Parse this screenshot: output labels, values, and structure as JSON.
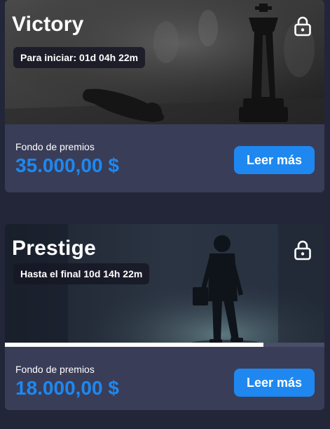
{
  "cards": [
    {
      "title": "Victory",
      "timer": "Para iniciar: 01d 04h 22m",
      "prize_label": "Fondo de premios",
      "prize_value": "35.000,00 $",
      "button_label": "Leer más",
      "lock_icon": "lock-icon"
    },
    {
      "title": "Prestige",
      "timer": "Hasta el final 10d 14h 22m",
      "prize_label": "Fondo de premios",
      "prize_value": "18.000,00 $",
      "button_label": "Leer más",
      "lock_icon": "lock-icon",
      "progress": 0.81
    }
  ],
  "colors": {
    "page_bg": "#222638",
    "card_bg": "#393d58",
    "accent": "#1e88f0"
  }
}
